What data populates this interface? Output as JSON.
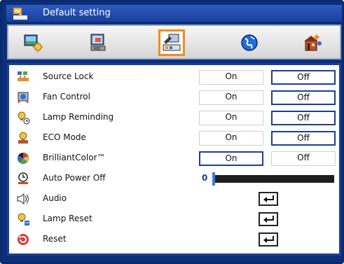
{
  "window": {
    "title": "Default setting"
  },
  "tabs": [
    {
      "icon": "image-settings-icon",
      "active": false
    },
    {
      "icon": "display-settings-icon",
      "active": false
    },
    {
      "icon": "setup-settings-icon",
      "active": true
    },
    {
      "icon": "language-globe-icon",
      "active": false
    },
    {
      "icon": "options-house-icon",
      "active": false
    }
  ],
  "rows": [
    {
      "label": "Source Lock",
      "icon": "source-lock-icon",
      "on": "On",
      "off": "Off",
      "selected": "off"
    },
    {
      "label": "Fan Control",
      "icon": "fan-control-icon",
      "on": "On",
      "off": "Off",
      "selected": "off"
    },
    {
      "label": "Lamp Reminding",
      "icon": "lamp-reminding-icon",
      "on": "On",
      "off": "Off",
      "selected": "off"
    },
    {
      "label": "ECO Mode",
      "icon": "eco-mode-icon",
      "on": "On",
      "off": "Off",
      "selected": "off"
    },
    {
      "label": "BrilliantColor™",
      "icon": "brilliantcolor-icon",
      "on": "On",
      "off": "Off",
      "selected": "on"
    }
  ],
  "auto_power_off": {
    "label": "Auto Power Off",
    "icon": "auto-power-off-icon",
    "value": "0",
    "level": 0
  },
  "actions": [
    {
      "label": "Audio",
      "icon": "speaker-icon"
    },
    {
      "label": "Lamp Reset",
      "icon": "lamp-reset-icon"
    },
    {
      "label": "Reset",
      "icon": "reset-icon"
    }
  ],
  "colors": {
    "frame": "#0b2f7a",
    "selected_border": "#1a3f95",
    "active_tab": "#f08c1e",
    "slider_knob": "#3a7fe0"
  }
}
